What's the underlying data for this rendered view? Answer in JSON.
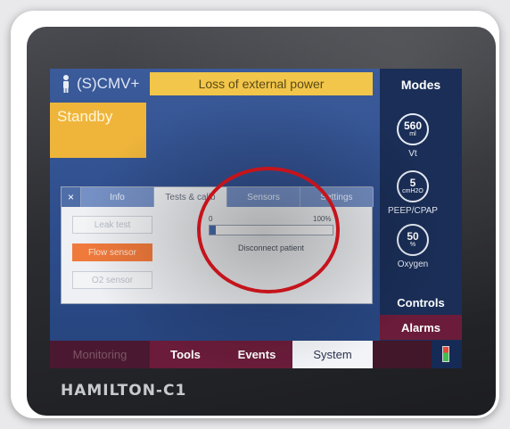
{
  "device": {
    "brand": "HAMILTON-C1"
  },
  "header": {
    "mode_label": "(S)CMV+",
    "alarm_message": "Loss of external power",
    "standby_label": "Standby"
  },
  "right_panel": {
    "modes_label": "Modes",
    "dials": [
      {
        "value": "560",
        "unit": "ml",
        "label": "Vt"
      },
      {
        "value": "5",
        "unit": "cmH2O",
        "label": "PEEP/CPAP"
      },
      {
        "value": "50",
        "unit": "%",
        "label": "Oxygen"
      }
    ],
    "controls_label": "Controls",
    "alarms_label": "Alarms"
  },
  "dialog": {
    "close_glyph": "×",
    "tabs": [
      {
        "label": "Info"
      },
      {
        "label": "Tests & calib"
      },
      {
        "label": "Sensors"
      },
      {
        "label": "Settings"
      }
    ],
    "buttons": [
      {
        "label": "Leak test"
      },
      {
        "label": "Flow sensor"
      },
      {
        "label": "O2 sensor"
      }
    ],
    "progress": {
      "min_label": "0",
      "max_label": "100%",
      "value_percent": 5
    },
    "message": "Disconnect patient"
  },
  "bottom_tabs": [
    {
      "label": "Monitoring"
    },
    {
      "label": "Tools"
    },
    {
      "label": "Events"
    },
    {
      "label": "System"
    }
  ],
  "colors": {
    "alarm_banner": "#f2c64a",
    "standby": "#efb53b",
    "active_button": "#f07a3c",
    "annotation_circle": "#c5141c"
  }
}
